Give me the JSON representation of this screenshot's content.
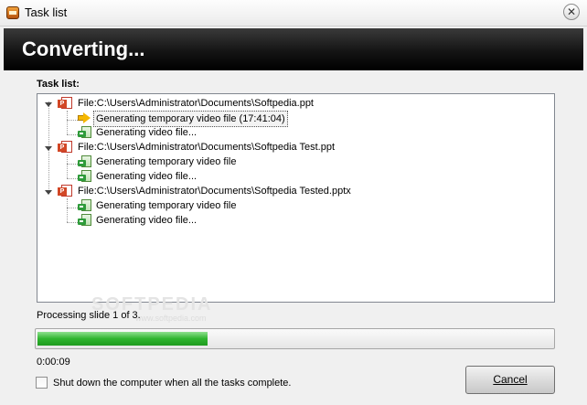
{
  "window": {
    "title": "Task list"
  },
  "header": {
    "title": "Converting..."
  },
  "task_list": {
    "label": "Task list:",
    "files": [
      {
        "path": "File:C:\\Users\\Administrator\\Documents\\Softpedia.ppt",
        "tasks": [
          "Generating temporary video file (17:41:04)",
          "Generating video file..."
        ]
      },
      {
        "path": "File:C:\\Users\\Administrator\\Documents\\Softpedia Test.ppt",
        "tasks": [
          "Generating temporary video file",
          "Generating video file..."
        ]
      },
      {
        "path": "File:C:\\Users\\Administrator\\Documents\\Softpedia Tested.pptx",
        "tasks": [
          "Generating temporary video file",
          "Generating video file..."
        ]
      }
    ]
  },
  "watermark": {
    "brand": "SOFTPEDIA",
    "url": "www.softpedia.com"
  },
  "status": {
    "text": "Processing slide 1 of 3.",
    "progress_fraction": 0.33,
    "elapsed": "0:00:09"
  },
  "options": {
    "shutdown_label": "Shut down the computer when all the tasks complete.",
    "shutdown_checked": false
  },
  "buttons": {
    "cancel": "Cancel"
  },
  "colors": {
    "progress_green": "#2fb52f",
    "header_bg": "#000000"
  }
}
